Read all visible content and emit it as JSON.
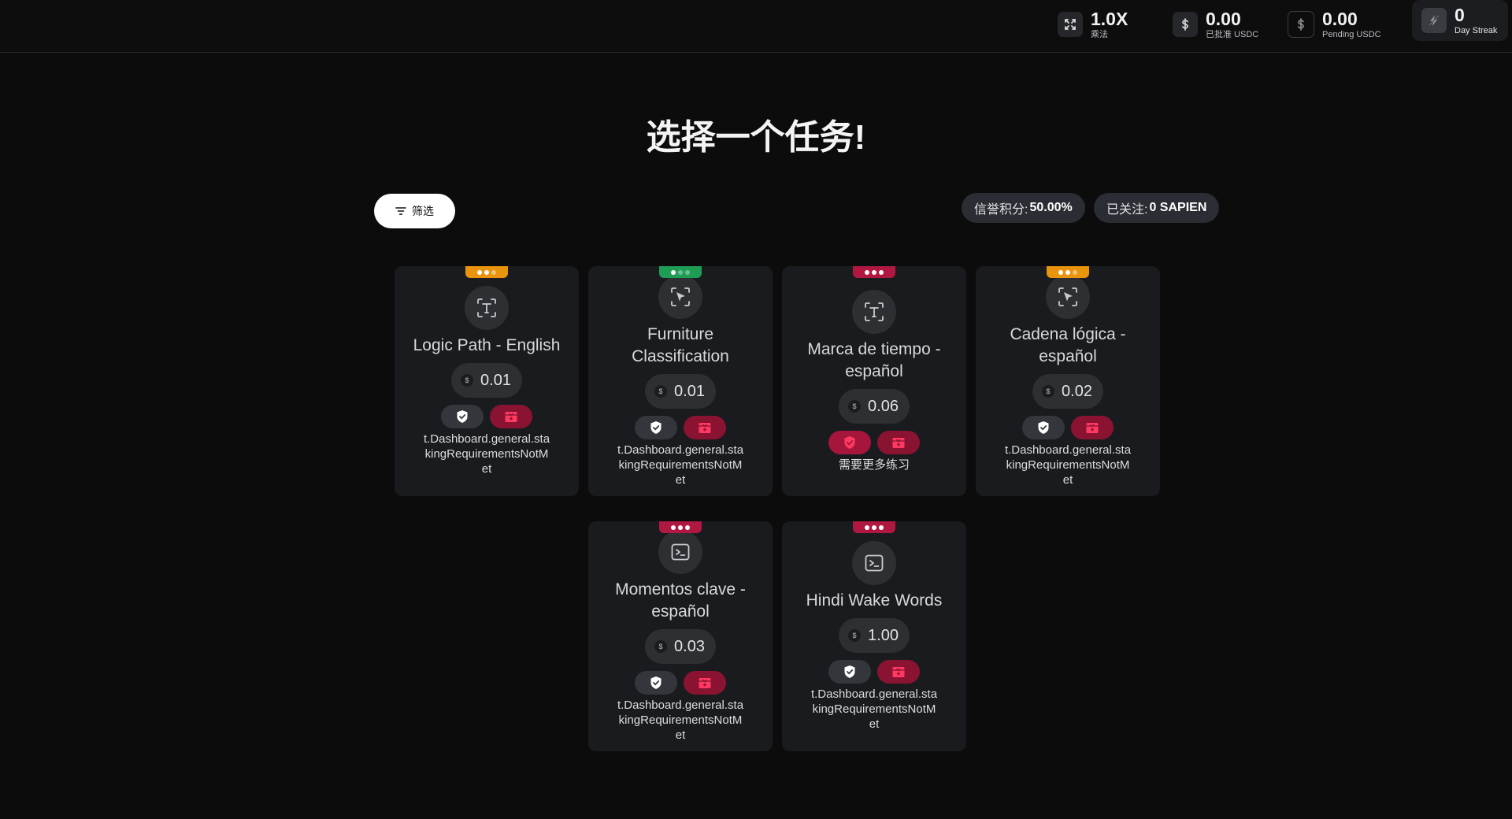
{
  "header": {
    "multiplier": {
      "value": "1.0X",
      "label": "乘法"
    },
    "approved": {
      "value": "0.00",
      "label": "已批准 USDC"
    },
    "pending": {
      "value": "0.00",
      "label": "Pending USDC"
    },
    "streak": {
      "value": "0",
      "label": "Day Streak"
    }
  },
  "page_title": "选择一个任务!",
  "filter": {
    "label": "筛选"
  },
  "reputation": {
    "label": "信誉积分:",
    "value": "50.00%"
  },
  "followed": {
    "label": "已关注:",
    "value": "0 SAPIEN"
  },
  "colors": {
    "orange": "#e8940c",
    "green": "#1f9d55",
    "red": "#b01842"
  },
  "tasks": [
    {
      "title": "Logic Path - English",
      "reward": "0.01",
      "icon": "text-icon",
      "difficulty_color": "#e8940c",
      "status": "t.Dashboard.general.stakingRequirementsNotMet"
    },
    {
      "title": "Furniture Classification",
      "reward": "0.01",
      "icon": "cursor-select-icon",
      "difficulty_color": "#1f9d55",
      "status": "t.Dashboard.general.stakingRequirementsNotMet"
    },
    {
      "title": "Marca de tiempo - español",
      "reward": "0.06",
      "icon": "text-icon",
      "difficulty_color": "#b01842",
      "status": "需要更多练习"
    },
    {
      "title": "Cadena lógica - español",
      "reward": "0.02",
      "icon": "cursor-select-icon",
      "difficulty_color": "#e8940c",
      "status": "t.Dashboard.general.stakingRequirementsNotMet"
    },
    {
      "title": "Momentos clave - español",
      "reward": "0.03",
      "icon": "terminal-icon",
      "difficulty_color": "#b01842",
      "status": "t.Dashboard.general.stakingRequirementsNotMet"
    },
    {
      "title": "Hindi Wake Words",
      "reward": "1.00",
      "icon": "terminal-icon",
      "difficulty_color": "#b01842",
      "status": "t.Dashboard.general.stakingRequirementsNotMet"
    }
  ]
}
